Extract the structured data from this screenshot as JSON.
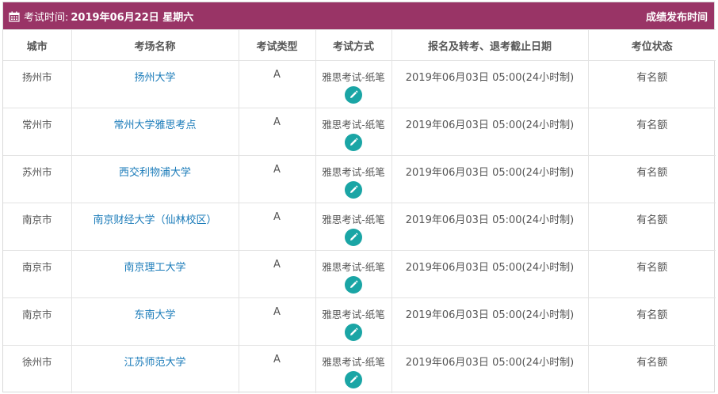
{
  "header": {
    "label": "考试时间:",
    "date": "2019年06月22日 星期六",
    "right_link": "成绩发布时间"
  },
  "columns": [
    "城市",
    "考场名称",
    "考试类型",
    "考试方式",
    "报名及转考、退考截止日期",
    "考位状态"
  ],
  "rows": [
    {
      "city": "扬州市",
      "venue": "扬州大学",
      "type": "A",
      "method": "雅思考试-纸笔",
      "deadline": "2019年06月03日 05:00(24小时制)",
      "status": "有名额"
    },
    {
      "city": "常州市",
      "venue": "常州大学雅思考点",
      "type": "A",
      "method": "雅思考试-纸笔",
      "deadline": "2019年06月03日 05:00(24小时制)",
      "status": "有名额"
    },
    {
      "city": "苏州市",
      "venue": "西交利物浦大学",
      "type": "A",
      "method": "雅思考试-纸笔",
      "deadline": "2019年06月03日 05:00(24小时制)",
      "status": "有名额"
    },
    {
      "city": "南京市",
      "venue": "南京财经大学（仙林校区）",
      "type": "A",
      "method": "雅思考试-纸笔",
      "deadline": "2019年06月03日 05:00(24小时制)",
      "status": "有名额"
    },
    {
      "city": "南京市",
      "venue": "南京理工大学",
      "type": "A",
      "method": "雅思考试-纸笔",
      "deadline": "2019年06月03日 05:00(24小时制)",
      "status": "有名额"
    },
    {
      "city": "南京市",
      "venue": "东南大学",
      "type": "A",
      "method": "雅思考试-纸笔",
      "deadline": "2019年06月03日 05:00(24小时制)",
      "status": "有名额"
    },
    {
      "city": "徐州市",
      "venue": "江苏师范大学",
      "type": "A",
      "method": "雅思考试-纸笔",
      "deadline": "2019年06月03日 05:00(24小时制)",
      "status": "有名额"
    }
  ],
  "icons": {
    "header": "calendar-icon",
    "row_action": "pencil-edit-icon"
  },
  "colors": {
    "header_bg": "#993466",
    "link": "#1a7bb9",
    "edit_button": "#1aa5a5"
  }
}
